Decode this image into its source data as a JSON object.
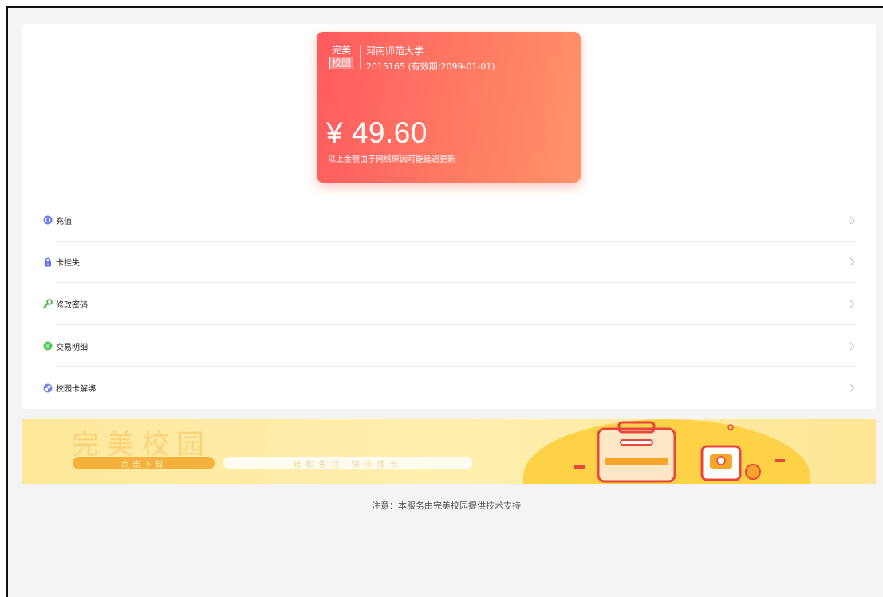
{
  "card": {
    "logo_line1": "完美",
    "logo_line2": "校园",
    "school": "河南师范大学",
    "id_line": "2015165 (有效期:2099-01-01)",
    "amount": "¥ 49.60",
    "note": "以上金额由于网络原因可能延迟更新"
  },
  "menu": {
    "items": [
      {
        "label": "充值",
        "icon": "recharge-icon",
        "color": "#6b7cf0"
      },
      {
        "label": "卡挂失",
        "icon": "lock-icon",
        "color": "#5b6ef0"
      },
      {
        "label": "修改密码",
        "icon": "key-icon",
        "color": "#3cb043"
      },
      {
        "label": "交易明细",
        "icon": "transaction-icon",
        "color": "#5ac85a"
      },
      {
        "label": "校园卡解绑",
        "icon": "link-icon",
        "color": "#7b86e8"
      }
    ]
  },
  "banner": {
    "title": "完美校园",
    "button_label": "点击下载",
    "slogan": "轻松生活 快乐成长"
  },
  "footer": {
    "note": "注意：本服务由完美校园提供技术支持"
  },
  "colors": {
    "card_gradient_start": "#ff5a5f",
    "card_gradient_end": "#ff9468",
    "background": "#f4f4f7"
  }
}
